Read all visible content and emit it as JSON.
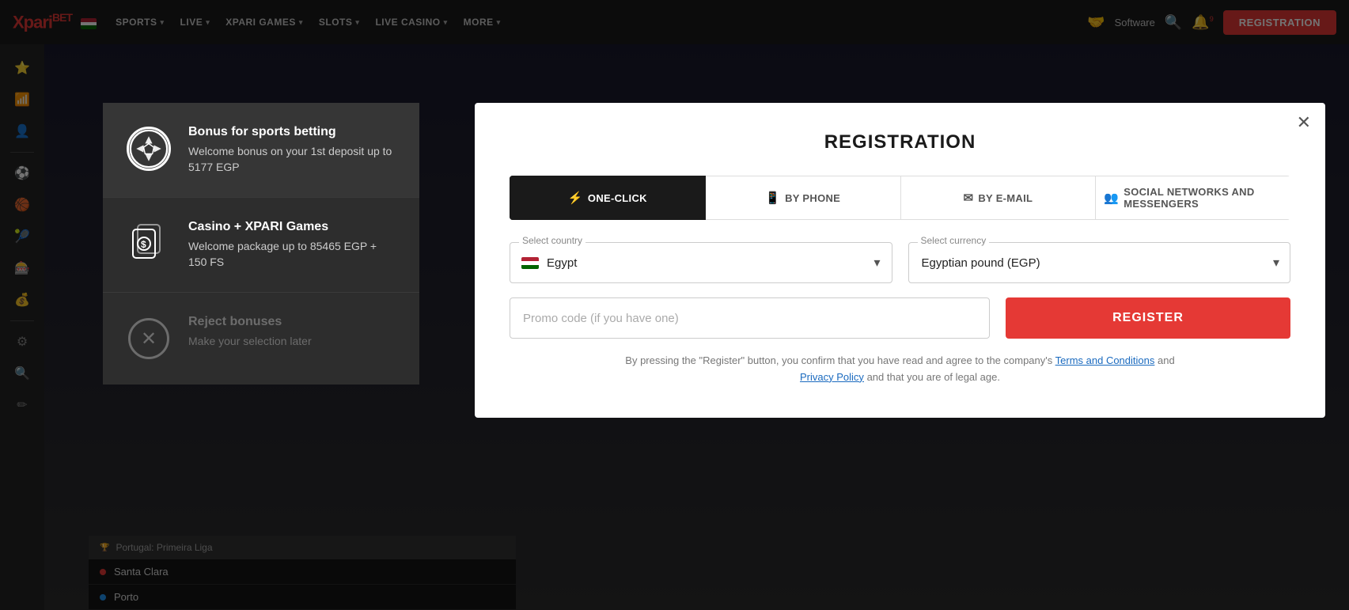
{
  "site": {
    "logo_main": "Xpari",
    "logo_accent": "BET"
  },
  "nav": {
    "items": [
      {
        "label": "SPORTS",
        "has_dropdown": true
      },
      {
        "label": "LIVE",
        "has_dropdown": true
      },
      {
        "label": "XPARI GAMES",
        "has_dropdown": true
      },
      {
        "label": "SLOTS",
        "has_dropdown": true
      },
      {
        "label": "LIVE CASINO",
        "has_dropdown": true
      },
      {
        "label": "MORE",
        "has_dropdown": true
      }
    ],
    "right": {
      "software_label": "Software",
      "register_label": "REGISTRATION"
    }
  },
  "bonus_panel": {
    "sports": {
      "title": "Bonus for sports betting",
      "description": "Welcome bonus on your 1st deposit up to 5177 EGP"
    },
    "casino": {
      "title": "Casino + XPARI Games",
      "description": "Welcome package up to 85465 EGP + 150 FS"
    },
    "reject": {
      "title": "Reject bonuses",
      "description": "Make your selection later"
    }
  },
  "registration": {
    "title": "REGISTRATION",
    "tabs": [
      {
        "id": "one-click",
        "label": "ONE-CLICK",
        "icon": "⚡",
        "active": true
      },
      {
        "id": "by-phone",
        "label": "BY PHONE",
        "icon": "📱",
        "active": false
      },
      {
        "id": "by-email",
        "label": "BY E-MAIL",
        "icon": "✉",
        "active": false
      },
      {
        "id": "social",
        "label": "SOCIAL NETWORKS AND MESSENGERS",
        "icon": "👥",
        "active": false
      }
    ],
    "country_label": "Select country",
    "country_value": "Egypt",
    "currency_label": "Select currency",
    "currency_value": "Egyptian pound (EGP)",
    "promo_placeholder": "Promo code (if you have one)",
    "register_button": "REGISTER",
    "terms_text": "By pressing the \"Register\" button, you confirm that you have read and agree to the company's",
    "terms_link": "Terms and Conditions",
    "terms_and": "and",
    "privacy_link": "Privacy Policy",
    "terms_end": "and that you are of legal age.",
    "close_icon": "✕"
  },
  "sports_list": {
    "header": "Portugal: Primeira Liga",
    "matches": [
      {
        "team1": "Santa Clara",
        "team2": ""
      },
      {
        "team1": "Porto",
        "team2": ""
      }
    ]
  },
  "sidebar": {
    "icons": [
      "⭐",
      "📶",
      "👤",
      "⚽",
      "🏀",
      "🎾",
      "🎰",
      "💰",
      "⚙",
      "🔍",
      "✏"
    ]
  },
  "colors": {
    "accent_red": "#e53935",
    "nav_bg": "#1c1c1c",
    "sidebar_bg": "#242424",
    "panel_dark": "#2d2d2d",
    "panel_darker": "#363636"
  }
}
